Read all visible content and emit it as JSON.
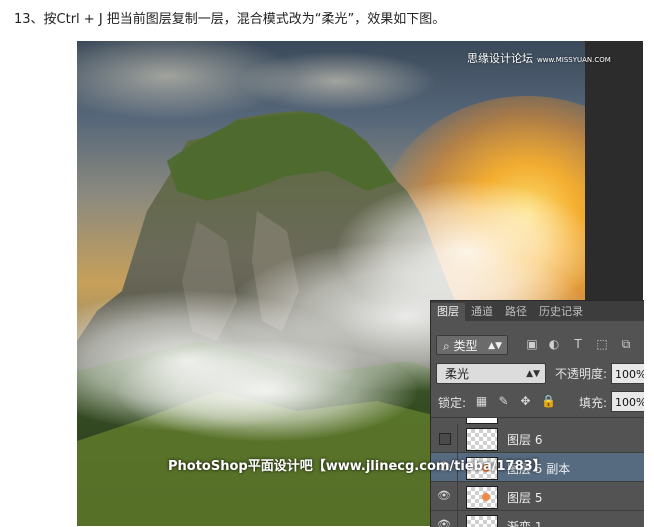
{
  "caption": "13、按Ctrl + J 把当前图层复制一层，混合模式改为“柔光”，效果如下图。",
  "watermarks": {
    "top": "思缘设计论坛",
    "top_url": "www.MISSYUAN.COM",
    "bottom": "PhotoShop平面设计吧【www.jlinecg.com/tieba/1783】"
  },
  "layers_panel": {
    "tabs": [
      "图层",
      "通道",
      "路径",
      "历史记录"
    ],
    "active_tab": 0,
    "filter_kind": "类型",
    "filter_icons": [
      "image-filter-icon",
      "adjustment-filter-icon",
      "text-filter-icon",
      "shape-filter-icon",
      "smart-object-filter-icon"
    ],
    "filter_glyphs": [
      "▣",
      "◐",
      "T",
      "⬚",
      "⧉"
    ],
    "blend_mode": "柔光",
    "opacity_label": "不透明度:",
    "opacity_value": "100%",
    "lock_label": "锁定:",
    "lock_glyphs": [
      "▦",
      "✎",
      "✥",
      "🔒"
    ],
    "fill_label": "填充:",
    "fill_value": "100%",
    "layers": [
      {
        "name": "图层 6",
        "visible": false,
        "selected": false
      },
      {
        "name": "图层 5 副本",
        "visible": true,
        "selected": true
      },
      {
        "name": "图层 5",
        "visible": true,
        "selected": false
      },
      {
        "name": "渐变 1",
        "visible": true,
        "selected": false
      }
    ]
  },
  "colors": {
    "panel_bg": "#535353",
    "selected_layer": "#566a80",
    "sun_glow": "#ffb428"
  }
}
